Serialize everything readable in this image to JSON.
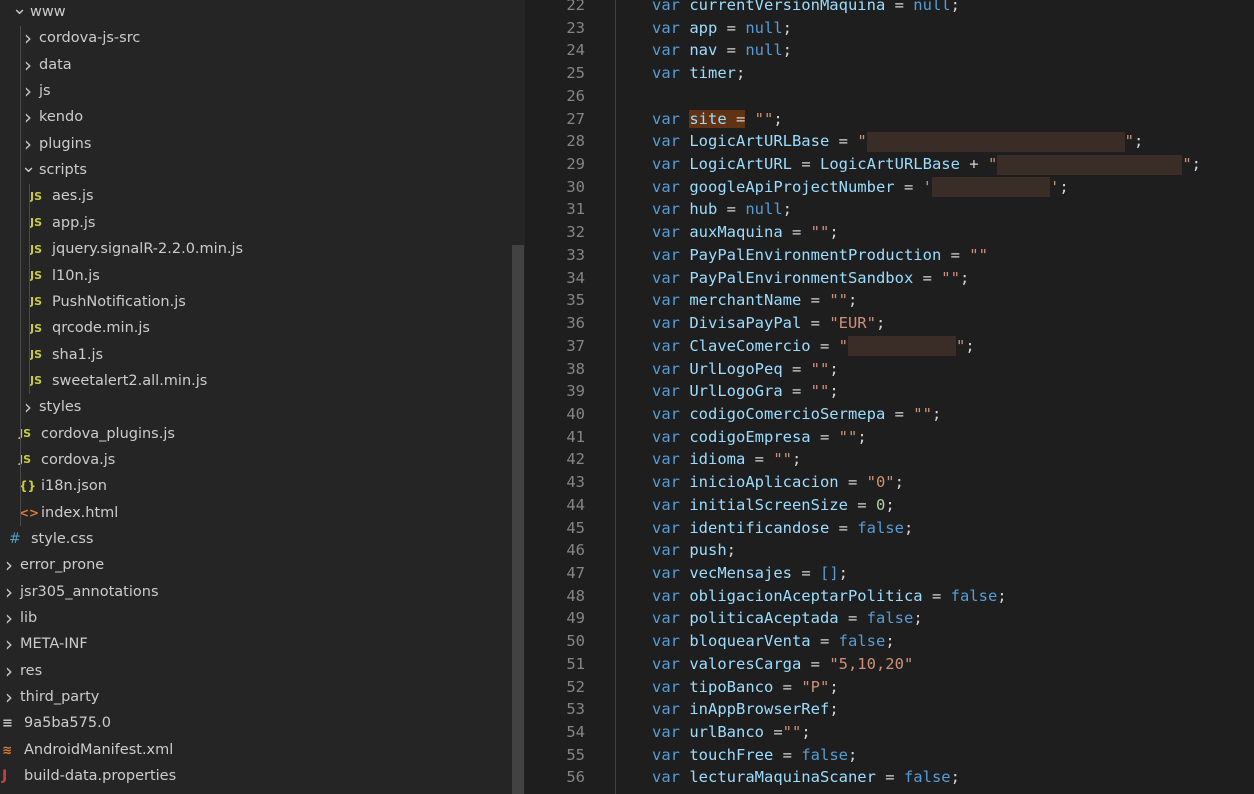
{
  "explorer": {
    "rows": [
      {
        "label": "www",
        "kind": "folder-open",
        "icon": "chevron-down-icon"
      },
      {
        "label": "cordova-js-src",
        "kind": "folder",
        "icon": "chevron-right-icon"
      },
      {
        "label": "data",
        "kind": "folder",
        "icon": "chevron-right-icon"
      },
      {
        "label": "js",
        "kind": "folder",
        "icon": "chevron-right-icon"
      },
      {
        "label": "kendo",
        "kind": "folder",
        "icon": "chevron-right-icon"
      },
      {
        "label": "plugins",
        "kind": "folder",
        "icon": "chevron-right-icon"
      },
      {
        "label": "scripts",
        "kind": "folder-open",
        "icon": "chevron-down-icon"
      },
      {
        "label": "aes.js",
        "kind": "js",
        "icon": "js-file-icon",
        "icon_text": "JS"
      },
      {
        "label": "app.js",
        "kind": "js",
        "icon": "js-file-icon",
        "icon_text": "JS"
      },
      {
        "label": "jquery.signalR-2.2.0.min.js",
        "kind": "js",
        "icon": "js-file-icon",
        "icon_text": "JS"
      },
      {
        "label": "l10n.js",
        "kind": "js",
        "icon": "js-file-icon",
        "icon_text": "JS"
      },
      {
        "label": "PushNotification.js",
        "kind": "js",
        "icon": "js-file-icon",
        "icon_text": "JS"
      },
      {
        "label": "qrcode.min.js",
        "kind": "js",
        "icon": "js-file-icon",
        "icon_text": "JS"
      },
      {
        "label": "sha1.js",
        "kind": "js",
        "icon": "js-file-icon",
        "icon_text": "JS"
      },
      {
        "label": "sweetalert2.all.min.js",
        "kind": "js",
        "icon": "js-file-icon",
        "icon_text": "JS"
      },
      {
        "label": "styles",
        "kind": "folder",
        "icon": "chevron-right-icon"
      },
      {
        "label": "cordova_plugins.js",
        "kind": "js",
        "icon": "js-file-icon",
        "icon_text": "JS"
      },
      {
        "label": "cordova.js",
        "kind": "js",
        "icon": "js-file-icon",
        "icon_text": "JS"
      },
      {
        "label": "i18n.json",
        "kind": "json",
        "icon": "json-file-icon",
        "icon_text": "{}"
      },
      {
        "label": "index.html",
        "kind": "html",
        "icon": "html-file-icon",
        "icon_text": "<>"
      },
      {
        "label": "style.css",
        "kind": "css",
        "icon": "css-file-icon",
        "icon_text": "#"
      },
      {
        "label": "error_prone",
        "kind": "folder",
        "icon": "chevron-right-icon"
      },
      {
        "label": "jsr305_annotations",
        "kind": "folder",
        "icon": "chevron-right-icon"
      },
      {
        "label": "lib",
        "kind": "folder",
        "icon": "chevron-right-icon"
      },
      {
        "label": "META-INF",
        "kind": "folder",
        "icon": "chevron-right-icon"
      },
      {
        "label": "res",
        "kind": "folder",
        "icon": "chevron-right-icon"
      },
      {
        "label": "third_party",
        "kind": "folder",
        "icon": "chevron-right-icon"
      },
      {
        "label": "9a5ba575.0",
        "kind": "file",
        "icon": "lines-file-icon",
        "icon_text": "≡"
      },
      {
        "label": "AndroidManifest.xml",
        "kind": "xml",
        "icon": "rss-file-icon",
        "icon_text": "≋"
      },
      {
        "label": "build-data.properties",
        "kind": "properties",
        "icon": "java-file-icon",
        "icon_text": "J"
      }
    ]
  },
  "editor": {
    "lines": [
      {
        "num": "22",
        "name": "currentVersionMaquina",
        "op": " = ",
        "value": "null",
        "vtype": "kw",
        "end": ";"
      },
      {
        "num": "23",
        "name": "app",
        "op": " = ",
        "value": "null",
        "vtype": "kw",
        "end": ";"
      },
      {
        "num": "24",
        "name": "nav",
        "op": " = ",
        "value": "null",
        "vtype": "kw",
        "end": ";"
      },
      {
        "num": "25",
        "name": "timer",
        "end": ";"
      },
      {
        "num": "26",
        "blank": true
      },
      {
        "num": "27",
        "name": "site",
        "highlight": true,
        "op": " = ",
        "value": "\"\"",
        "vtype": "str",
        "end": ";"
      },
      {
        "num": "28",
        "name": "LogicArtURLBase",
        "op": " = ",
        "value": "\"",
        "vtype": "str",
        "redact": 258,
        "tail": "\"",
        "end": ";"
      },
      {
        "num": "29",
        "name": "LogicArtURL",
        "op": " = ",
        "extra": "LogicArtURLBase",
        "op2": " + ",
        "value": "\"",
        "vtype": "str",
        "redact": 185,
        "tail": "\"",
        "end": ";"
      },
      {
        "num": "30",
        "name": "googleApiProjectNumber",
        "op": " = ",
        "value": "'",
        "vtype": "str",
        "redact": 118,
        "tail": "'",
        "end": ";"
      },
      {
        "num": "31",
        "name": "hub",
        "op": " = ",
        "value": "null",
        "vtype": "kw",
        "end": ";"
      },
      {
        "num": "32",
        "name": "auxMaquina",
        "op": " = ",
        "value": "\"\"",
        "vtype": "str",
        "end": ";"
      },
      {
        "num": "33",
        "name": "PayPalEnvironmentProduction",
        "op": " = ",
        "value": "\"\"",
        "vtype": "str",
        "end": ""
      },
      {
        "num": "34",
        "name": "PayPalEnvironmentSandbox",
        "op": " = ",
        "value": "\"\"",
        "vtype": "str",
        "end": ";"
      },
      {
        "num": "35",
        "name": "merchantName",
        "op": " = ",
        "value": "\"\"",
        "vtype": "str",
        "end": ";"
      },
      {
        "num": "36",
        "name": "DivisaPayPal",
        "op": " = ",
        "value": "\"EUR\"",
        "vtype": "str",
        "end": ";"
      },
      {
        "num": "37",
        "name": "ClaveComercio",
        "op": " = ",
        "value": "\"",
        "vtype": "str",
        "redact": 108,
        "tail": "\"",
        "end": ";"
      },
      {
        "num": "38",
        "name": "UrlLogoPeq",
        "op": " = ",
        "value": "\"\"",
        "vtype": "str",
        "end": ";"
      },
      {
        "num": "39",
        "name": "UrlLogoGra",
        "op": " = ",
        "value": "\"\"",
        "vtype": "str",
        "end": ";"
      },
      {
        "num": "40",
        "name": "codigoComercioSermepa",
        "op": " = ",
        "value": "\"\"",
        "vtype": "str",
        "end": ";"
      },
      {
        "num": "41",
        "name": "codigoEmpresa",
        "op": " = ",
        "value": "\"\"",
        "vtype": "str",
        "end": ";"
      },
      {
        "num": "42",
        "name": "idioma",
        "op": " = ",
        "value": "\"\"",
        "vtype": "str",
        "end": ";"
      },
      {
        "num": "43",
        "name": "inicioAplicacion",
        "op": " = ",
        "value": "\"0\"",
        "vtype": "str",
        "end": ";"
      },
      {
        "num": "44",
        "name": "initialScreenSize",
        "op": " = ",
        "value": "0",
        "vtype": "num",
        "end": ";"
      },
      {
        "num": "45",
        "name": "identificandose",
        "op": " = ",
        "value": "false",
        "vtype": "kw",
        "end": ";"
      },
      {
        "num": "46",
        "name": "push",
        "end": ";"
      },
      {
        "num": "47",
        "name": "vecMensajes",
        "op": " = ",
        "value": "[]",
        "vtype": "kw",
        "end": ";"
      },
      {
        "num": "48",
        "name": "obligacionAceptarPolitica",
        "op": " = ",
        "value": "false",
        "vtype": "kw",
        "end": ";"
      },
      {
        "num": "49",
        "name": "politicaAceptada",
        "op": " = ",
        "value": "false",
        "vtype": "kw",
        "end": ";"
      },
      {
        "num": "50",
        "name": "bloquearVenta",
        "op": " = ",
        "value": "false",
        "vtype": "kw",
        "end": ";"
      },
      {
        "num": "51",
        "name": "valoresCarga",
        "op": " = ",
        "value": "\"5,10,20\"",
        "vtype": "str",
        "end": ""
      },
      {
        "num": "52",
        "name": "tipoBanco",
        "op": " = ",
        "value": "\"P\"",
        "vtype": "str",
        "end": ";"
      },
      {
        "num": "53",
        "name": "inAppBrowserRef",
        "end": ";"
      },
      {
        "num": "54",
        "name": "urlBanco",
        "op": " =",
        "value": "\"\"",
        "vtype": "str",
        "end": ";"
      },
      {
        "num": "55",
        "name": "touchFree",
        "op": " = ",
        "value": "false",
        "vtype": "kw",
        "end": ";"
      },
      {
        "num": "56",
        "name": "lecturaMaquinaScaner",
        "op": " = ",
        "value": "false",
        "vtype": "kw",
        "end": ";"
      }
    ],
    "keyword": "var"
  },
  "colors": {
    "keyword": "#569cd6",
    "variable": "#9cdcfe",
    "string": "#ce9178",
    "number": "#b5cea8",
    "highlight": "#613214"
  }
}
